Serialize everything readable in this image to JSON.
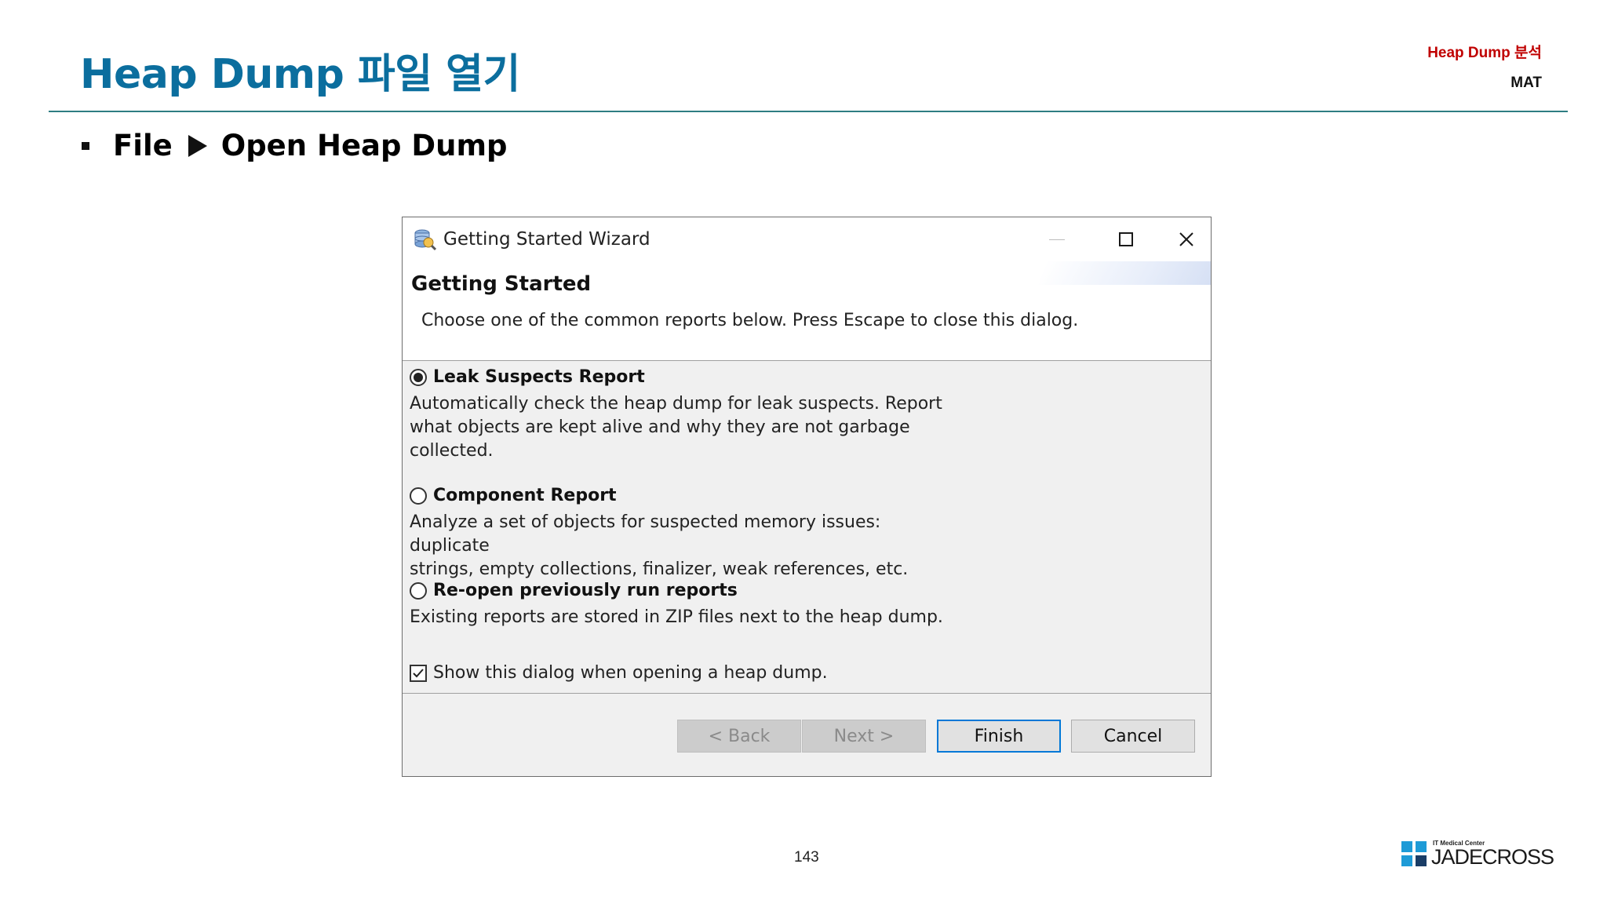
{
  "slide": {
    "title": "Heap Dump 파일 열기",
    "context": "Heap Dump 분석",
    "subcontext": "MAT",
    "bullet_file": "File",
    "bullet_action": "Open Heap Dump",
    "page_number": "143",
    "logo_small": "IT Medical Center",
    "logo_main": "JADECROSS",
    "colors": {
      "title": "#0b6e9e",
      "context": "#c00000",
      "rule": "#2e7d82",
      "logo_blue": "#1e9bd7",
      "logo_dark": "#1a3d66"
    }
  },
  "dialog": {
    "window_title": "Getting Started Wizard",
    "icon": "wizard-app-icon",
    "banner_title": "Getting Started",
    "banner_desc": "Choose one of the common reports below. Press Escape to close this dialog.",
    "options": [
      {
        "label": "Leak Suspects Report",
        "selected": true,
        "desc_lines": [
          "Automatically check the heap dump for leak suspects. Report",
          "what objects are kept alive and why they are not garbage",
          "collected."
        ]
      },
      {
        "label": "Component Report",
        "selected": false,
        "desc_lines": [
          "Analyze a set of objects for suspected memory issues: duplicate",
          "strings, empty collections, finalizer, weak references, etc."
        ]
      },
      {
        "label": "Re-open previously run reports",
        "selected": false,
        "desc_lines": [
          "Existing reports are stored in ZIP files next to the heap dump."
        ]
      }
    ],
    "show_dialog_label": "Show this dialog when opening a heap dump.",
    "show_dialog_checked": true,
    "buttons": {
      "back": "< Back",
      "next": "Next >",
      "finish": "Finish",
      "cancel": "Cancel"
    }
  }
}
